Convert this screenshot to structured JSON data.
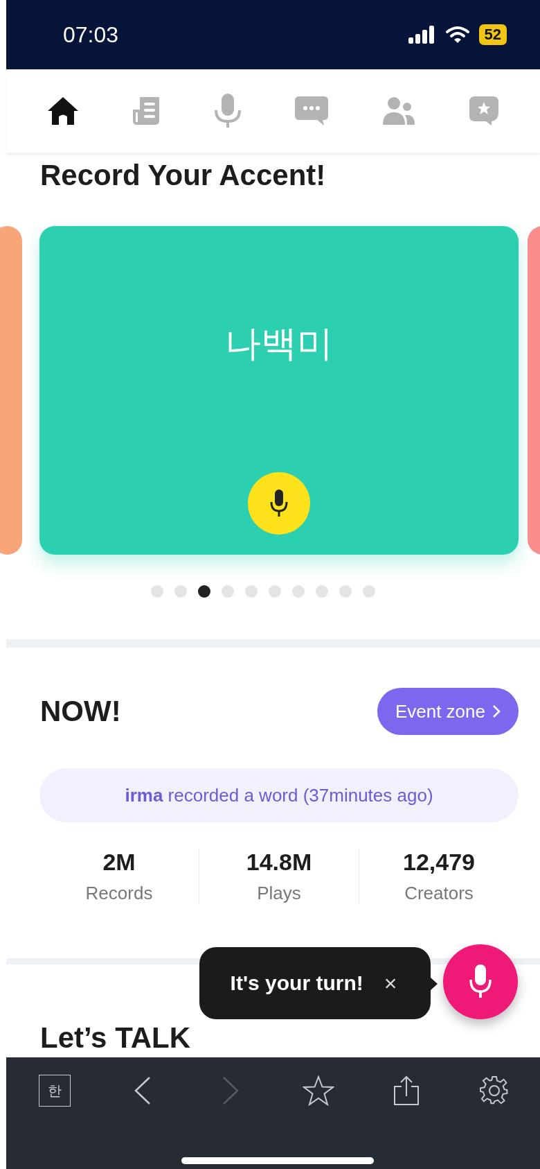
{
  "status_bar": {
    "time": "07:03",
    "battery": "52"
  },
  "nav_tabs": [
    {
      "kind": "home",
      "selected": true
    },
    {
      "kind": "news",
      "selected": false
    },
    {
      "kind": "mic",
      "selected": false
    },
    {
      "kind": "chat",
      "selected": false
    },
    {
      "kind": "people",
      "selected": false
    },
    {
      "kind": "favorites",
      "selected": false
    }
  ],
  "record_section": {
    "title": "Record Your Accent!",
    "cards": [
      {
        "color": "#f9a57a"
      },
      {
        "color": "#2ccfb0",
        "word": "나백미"
      },
      {
        "color": "#f98e8c"
      }
    ],
    "dots": [
      {
        "selected": false
      },
      {
        "selected": false
      },
      {
        "selected": true
      },
      {
        "selected": false
      },
      {
        "selected": false
      },
      {
        "selected": false
      },
      {
        "selected": false
      },
      {
        "selected": false
      },
      {
        "selected": false
      },
      {
        "selected": false
      }
    ]
  },
  "now_section": {
    "title": "NOW!",
    "button": "Event zone",
    "activity": "**irma** recorded a word (37minutes ago)",
    "stats": [
      {
        "value": "2M",
        "label": "Records"
      },
      {
        "value": "14.8M",
        "label": "Plays"
      },
      {
        "value": "12,479",
        "label": "Creators"
      }
    ]
  },
  "talk_section": {
    "title": "Let’s TALK"
  },
  "tooltip": {
    "text": "It's your turn!",
    "close": "×"
  },
  "browser_toolbar": [
    {
      "kind": "language",
      "label": "한",
      "disabled": false
    },
    {
      "kind": "back",
      "disabled": false
    },
    {
      "kind": "forward",
      "disabled": true
    },
    {
      "kind": "bookmark",
      "disabled": false
    },
    {
      "kind": "share",
      "disabled": false
    },
    {
      "kind": "settings",
      "disabled": false
    }
  ]
}
